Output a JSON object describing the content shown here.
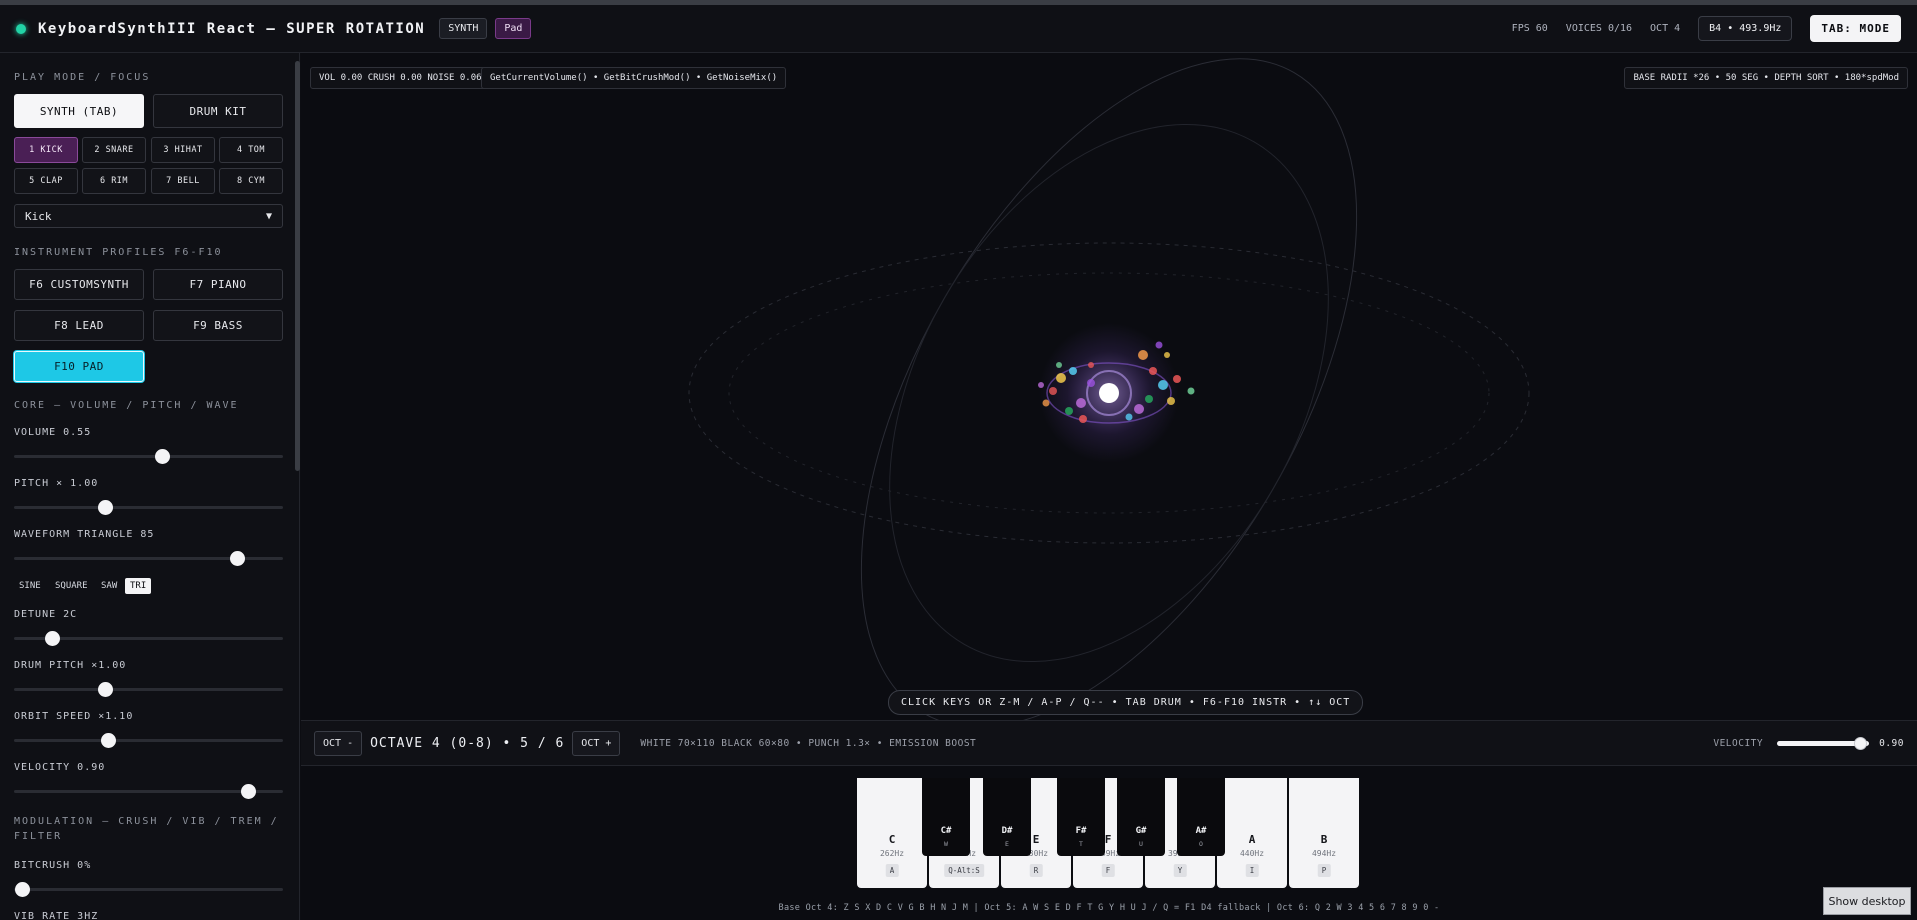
{
  "header": {
    "title": "KeyboardSynthIII React — SUPER ROTATION",
    "mode_tag": "SYNTH",
    "profile_tag": "Pad",
    "fps": "FPS 60",
    "voices": "VOICES 0/16",
    "octave": "OCT 4",
    "note": "B4 • 493.9Hz",
    "mode_button": "TAB: MODE"
  },
  "sidebar": {
    "play_mode_title": "PLAY MODE / FOCUS",
    "synth_button": "SYNTH (TAB)",
    "drum_button": "DRUM KIT",
    "drums": [
      "1 KICK",
      "2 SNARE",
      "3 HIHAT",
      "4 TOM",
      "5 CLAP",
      "6 RIM",
      "7 BELL",
      "8 CYM"
    ],
    "drum_select": "Kick",
    "profiles_title": "INSTRUMENT PROFILES F6-F10",
    "profiles": [
      "F6 CUSTOMSYNTH",
      "F7 PIANO",
      "F8 LEAD",
      "F9 BASS",
      "F10 PAD"
    ],
    "core_title": "CORE — VOLUME / PITCH / WAVE",
    "sliders": {
      "volume": {
        "label": "VOLUME 0.55",
        "value": 0.55
      },
      "pitch": {
        "label": "PITCH × 1.00",
        "value": 0.34
      },
      "waveform": {
        "label": "WAVEFORM TRIANGLE 85",
        "value": 0.83
      },
      "detune": {
        "label": "DETUNE 2c",
        "value": 0.14
      },
      "drum_pitch": {
        "label": "DRUM PITCH ×1.00",
        "value": 0.34
      },
      "orbit_speed": {
        "label": "ORBIT SPEED ×1.10",
        "value": 0.35
      },
      "velocity": {
        "label": "VELOCITY 0.90",
        "value": 0.87
      },
      "bitcrush": {
        "label": "BITCRUSH 0%",
        "value": 0.03
      }
    },
    "waveforms": [
      "SINE",
      "SQUARE",
      "SAW",
      "TRI"
    ],
    "modulation_title_1": "MODULATION — CRUSH / VIB / TREM /",
    "modulation_title_2": "FILTER",
    "vib_rate": "VIB RATE 3Hz"
  },
  "stage": {
    "hud_left": "VOL 0.00 CRUSH 0.00 NOISE 0.06",
    "hud_funcs": "GetCurrentVolume() • GetBitCrushMod() • GetNoiseMix()",
    "hud_right": "BASE RADII *26 • 50 SEG • DEPTH SORT • 180*spdMod",
    "help": "CLICK KEYS OR Z-M / A-P / Q-- • TAB DRUM • F6-F10 INSTR • ↑↓ OCT"
  },
  "octave_bar": {
    "down": "OCT -",
    "label": "OCTAVE 4 (0-8) • 5 / 6",
    "up": "OCT +",
    "info": "WHITE 70×110 BLACK 60×80 • PUNCH 1.3× • EMISSION BOOST",
    "velocity_label": "VELOCITY",
    "velocity_value": "0.90",
    "velocity_level": 0.9
  },
  "keyboard": {
    "white_keys": [
      {
        "note": "C",
        "hz": "262Hz",
        "key": "A"
      },
      {
        "note": "D",
        "hz": "294Hz",
        "key": "Q-Alt:S"
      },
      {
        "note": "E",
        "hz": "330Hz",
        "key": "R"
      },
      {
        "note": "F",
        "hz": "349Hz",
        "key": "F"
      },
      {
        "note": "G",
        "hz": "392Hz",
        "key": "Y"
      },
      {
        "note": "A",
        "hz": "440Hz",
        "key": "I"
      },
      {
        "note": "B",
        "hz": "494Hz",
        "key": "P"
      }
    ],
    "black_keys": [
      {
        "note": "C#",
        "key": "W"
      },
      {
        "note": "D#",
        "key": "E"
      },
      {
        "note": "F#",
        "key": "T"
      },
      {
        "note": "G#",
        "key": "U"
      },
      {
        "note": "A#",
        "key": "O"
      }
    ],
    "hint": "Base Oct 4: Z S X D C V G B H N J M  |  Oct 5: A W S E D F T G Y H U J / Q = F1 D4 fallback  |  Oct 6: Q 2 W 3 4 5 6 7 8 9 0 -"
  },
  "taskbar": {
    "show_desktop": "Show desktop"
  }
}
